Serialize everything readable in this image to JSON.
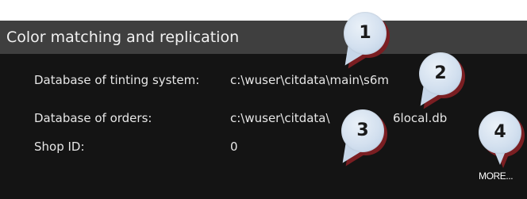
{
  "panel": {
    "title": "Color matching and replication",
    "rows": [
      {
        "label": "Database of tinting system:",
        "value": "c:\\wuser\\citdata\\main\\s6m"
      },
      {
        "label": "Database of orders:",
        "value": "c:\\wuser\\citdata\\",
        "value_suffix": "6local.db"
      },
      {
        "label": "Shop ID:",
        "value": "0"
      }
    ],
    "more_label": "MORE..."
  },
  "callouts": [
    {
      "number": "1"
    },
    {
      "number": "2"
    },
    {
      "number": "3"
    },
    {
      "number": "4"
    }
  ],
  "colors": {
    "panel_background": "#141414",
    "title_bar": "#3f3f3f",
    "callout_fill": "#d3e0ef",
    "callout_shadow": "#7a1e22"
  }
}
